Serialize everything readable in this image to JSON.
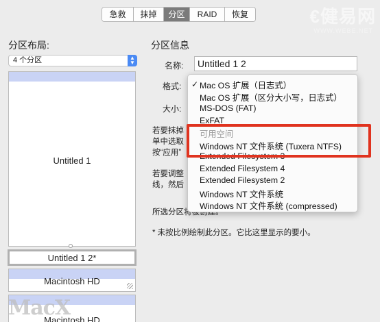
{
  "tabs": [
    {
      "label": "急救",
      "active": false
    },
    {
      "label": "抹掉",
      "active": false
    },
    {
      "label": "分区",
      "active": true
    },
    {
      "label": "RAID",
      "active": false
    },
    {
      "label": "恢复",
      "active": false
    }
  ],
  "watermark": {
    "logo": "€健易网",
    "url": "WWW.WEBE.NET"
  },
  "left": {
    "title": "分区布局:",
    "layout_select": "4 个分区",
    "partitions": [
      "Untitled 1",
      "Untitled 1 2*",
      "Macintosh HD",
      "Macintosh HD"
    ],
    "watermark": "MacX"
  },
  "right": {
    "title": "分区信息",
    "name_label": "名称:",
    "name_value": "Untitled 1 2",
    "format_label": "格式:",
    "size_label": "大小:",
    "para1": [
      "若要抹掉",
      "单中选取",
      "按“应用”"
    ],
    "para2": [
      "若要调整",
      "线，然后"
    ],
    "selected_text": "所选分区将被创建。",
    "note": "* 未按比例绘制此分区。它比这里显示的要小。"
  },
  "menu": {
    "items": [
      {
        "label": "Mac OS 扩展（日志式）",
        "checked": true,
        "disabled": false
      },
      {
        "label": "Mac OS 扩展（区分大小写，日志式）",
        "checked": false,
        "disabled": false
      },
      {
        "label": "MS-DOS (FAT)",
        "checked": false,
        "disabled": false
      },
      {
        "label": "ExFAT",
        "checked": false,
        "disabled": false
      },
      {
        "label": "可用空间",
        "checked": false,
        "disabled": true
      },
      {
        "label": "Windows NT 文件系统 (Tuxera NTFS)",
        "checked": false,
        "disabled": false
      },
      {
        "label": "Extended Filesystem 3",
        "checked": false,
        "disabled": false
      },
      {
        "label": "Extended Filesystem 4",
        "checked": false,
        "disabled": false
      },
      {
        "label": "Extended Filesystem 2",
        "checked": false,
        "disabled": false
      },
      {
        "label": "Windows NT 文件系统",
        "checked": false,
        "disabled": false
      },
      {
        "label": "Windows NT 文件系统 (compressed)",
        "checked": false,
        "disabled": false
      }
    ],
    "check_glyph": "✓"
  },
  "colors": {
    "highlight": "#e0331f",
    "selected_tab": "#7b7b7b",
    "partition_bar": "#c9d3f5"
  }
}
